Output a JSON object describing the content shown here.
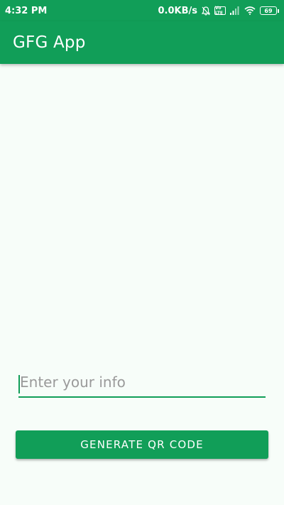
{
  "status_bar": {
    "time": "4:32 PM",
    "network_speed": "0.0KB/s",
    "battery_level": "69",
    "volte_label": "Vo LTE",
    "icons": [
      "mute-bell-icon",
      "volte-icon",
      "signal-icon",
      "wifi-icon",
      "battery-icon"
    ]
  },
  "app_bar": {
    "title": "GFG App"
  },
  "form": {
    "input_placeholder": "Enter your info",
    "input_value": "",
    "button_label": "GENERATE QR CODE"
  },
  "colors": {
    "primary": "#119e58",
    "background": "#f7fdf9",
    "on_primary": "#ffffff"
  }
}
